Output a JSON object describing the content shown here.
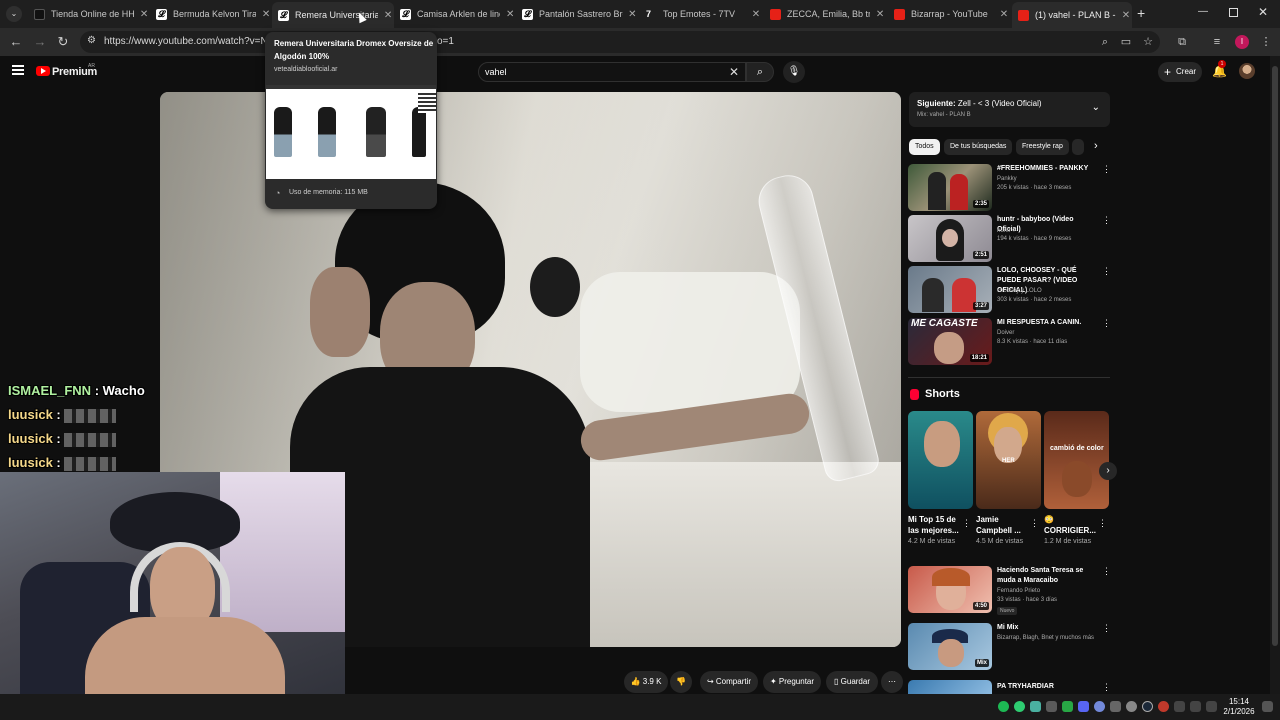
{
  "browser": {
    "tabs": [
      {
        "title": "Tienda Online de HH",
        "icon": "generic-favicon"
      },
      {
        "title": "Bermuda Kelvon Tira",
        "icon": "store-favicon"
      },
      {
        "title": "Remera Universitaria",
        "icon": "store-favicon"
      },
      {
        "title": "Camisa Arklen de line",
        "icon": "store-favicon"
      },
      {
        "title": "Pantalón Sastrero Bre",
        "icon": "store-favicon"
      },
      {
        "title": "Top Emotes - 7TV",
        "icon": "7tv-favicon"
      },
      {
        "title": "ZECCA, Emilia, Bb tr",
        "icon": "youtube-favicon"
      },
      {
        "title": "Bizarrap - YouTube",
        "icon": "youtube-favicon"
      },
      {
        "title": "(1) vahel - PLAN B -",
        "icon": "youtube-favicon"
      }
    ],
    "url": "https://www.youtube.com/watch?v=Ns",
    "url_tail": "o=1"
  },
  "hovercard": {
    "title": "Remera Universitaria Dromex Oversize de Algodón 100%",
    "domain": "vetealdiablooficial.ar",
    "memory": "Uso de memoria: 115 MB"
  },
  "youtube": {
    "brand": "Premium",
    "country": "AR",
    "search_value": "vahel",
    "create_label": "Crear",
    "notifications": "1"
  },
  "chat": [
    {
      "user": "ISMAEL_FNN",
      "msg": ": Wacho"
    },
    {
      "user": "luusick",
      "msg": ":"
    },
    {
      "user": "luusick",
      "msg": ":"
    },
    {
      "user": "luusick",
      "msg": ":"
    }
  ],
  "actions": {
    "likes": "3.9 K",
    "share": "Compartir",
    "ask": "Preguntar",
    "save": "Guardar"
  },
  "upnext": {
    "label": "Siguiente:",
    "title": "Zell - < 3 (Video Oficial)",
    "mix": "Mix: vahel - PLAN B"
  },
  "chips": [
    "Todos",
    "De tus búsquedas",
    "Freestyle rap"
  ],
  "recs": [
    {
      "title": "#FREEHOMMIES - PANKKY",
      "channel": "Pankky",
      "meta": "205 k vistas · hace 3 meses",
      "duration": "2:35"
    },
    {
      "title": "huntr - babyboo (Video Oficial)",
      "channel": "huntr",
      "meta": "194 k vistas · hace 9 meses",
      "duration": "2:51"
    },
    {
      "title": "LOLO, CHOOSEY - QUÉ PUEDE PASAR? (VIDEO OFICIAL)",
      "channel": "choosey y LOLO",
      "meta": "303 k vistas · hace 2 meses",
      "duration": "3:27"
    },
    {
      "title": "MI RESPUESTA A CANIN.",
      "channel": "Doiver",
      "meta": "8.3 K vistas · hace 11 días",
      "duration": "18:21",
      "thumb_text": "ME CAGASTE"
    }
  ],
  "shorts": {
    "heading": "Shorts",
    "items": [
      {
        "title": "Mi Top 15 de las mejores...",
        "views": "4.2 M de vistas"
      },
      {
        "title": "Jamie Campbell ...",
        "views": "4.5 M de vistas",
        "thumb_text": "HER"
      },
      {
        "title": "😳 CORRIGIER...",
        "views": "1.2 M de vistas",
        "thumb_text": "cambió de color"
      }
    ]
  },
  "recs2": [
    {
      "title": "Haciendo Santa Teresa se muda a Maracaibo",
      "channel": "Fernando Prieto",
      "meta": "33 vistas · hace 3 días",
      "duration": "4:50",
      "badge": "Nuevo"
    },
    {
      "title": "Mi Mix",
      "channel": "Bizarrap, Blagh, Bnet y muchos más",
      "duration": "Mix"
    },
    {
      "title": "PA TRYHARDIAR"
    }
  ],
  "taskbar": {
    "time": "15:14",
    "date": "2/1/2026"
  },
  "colors": {
    "accent": "#ff0000",
    "bg": "#0f0f0f",
    "chip": "#272727"
  }
}
